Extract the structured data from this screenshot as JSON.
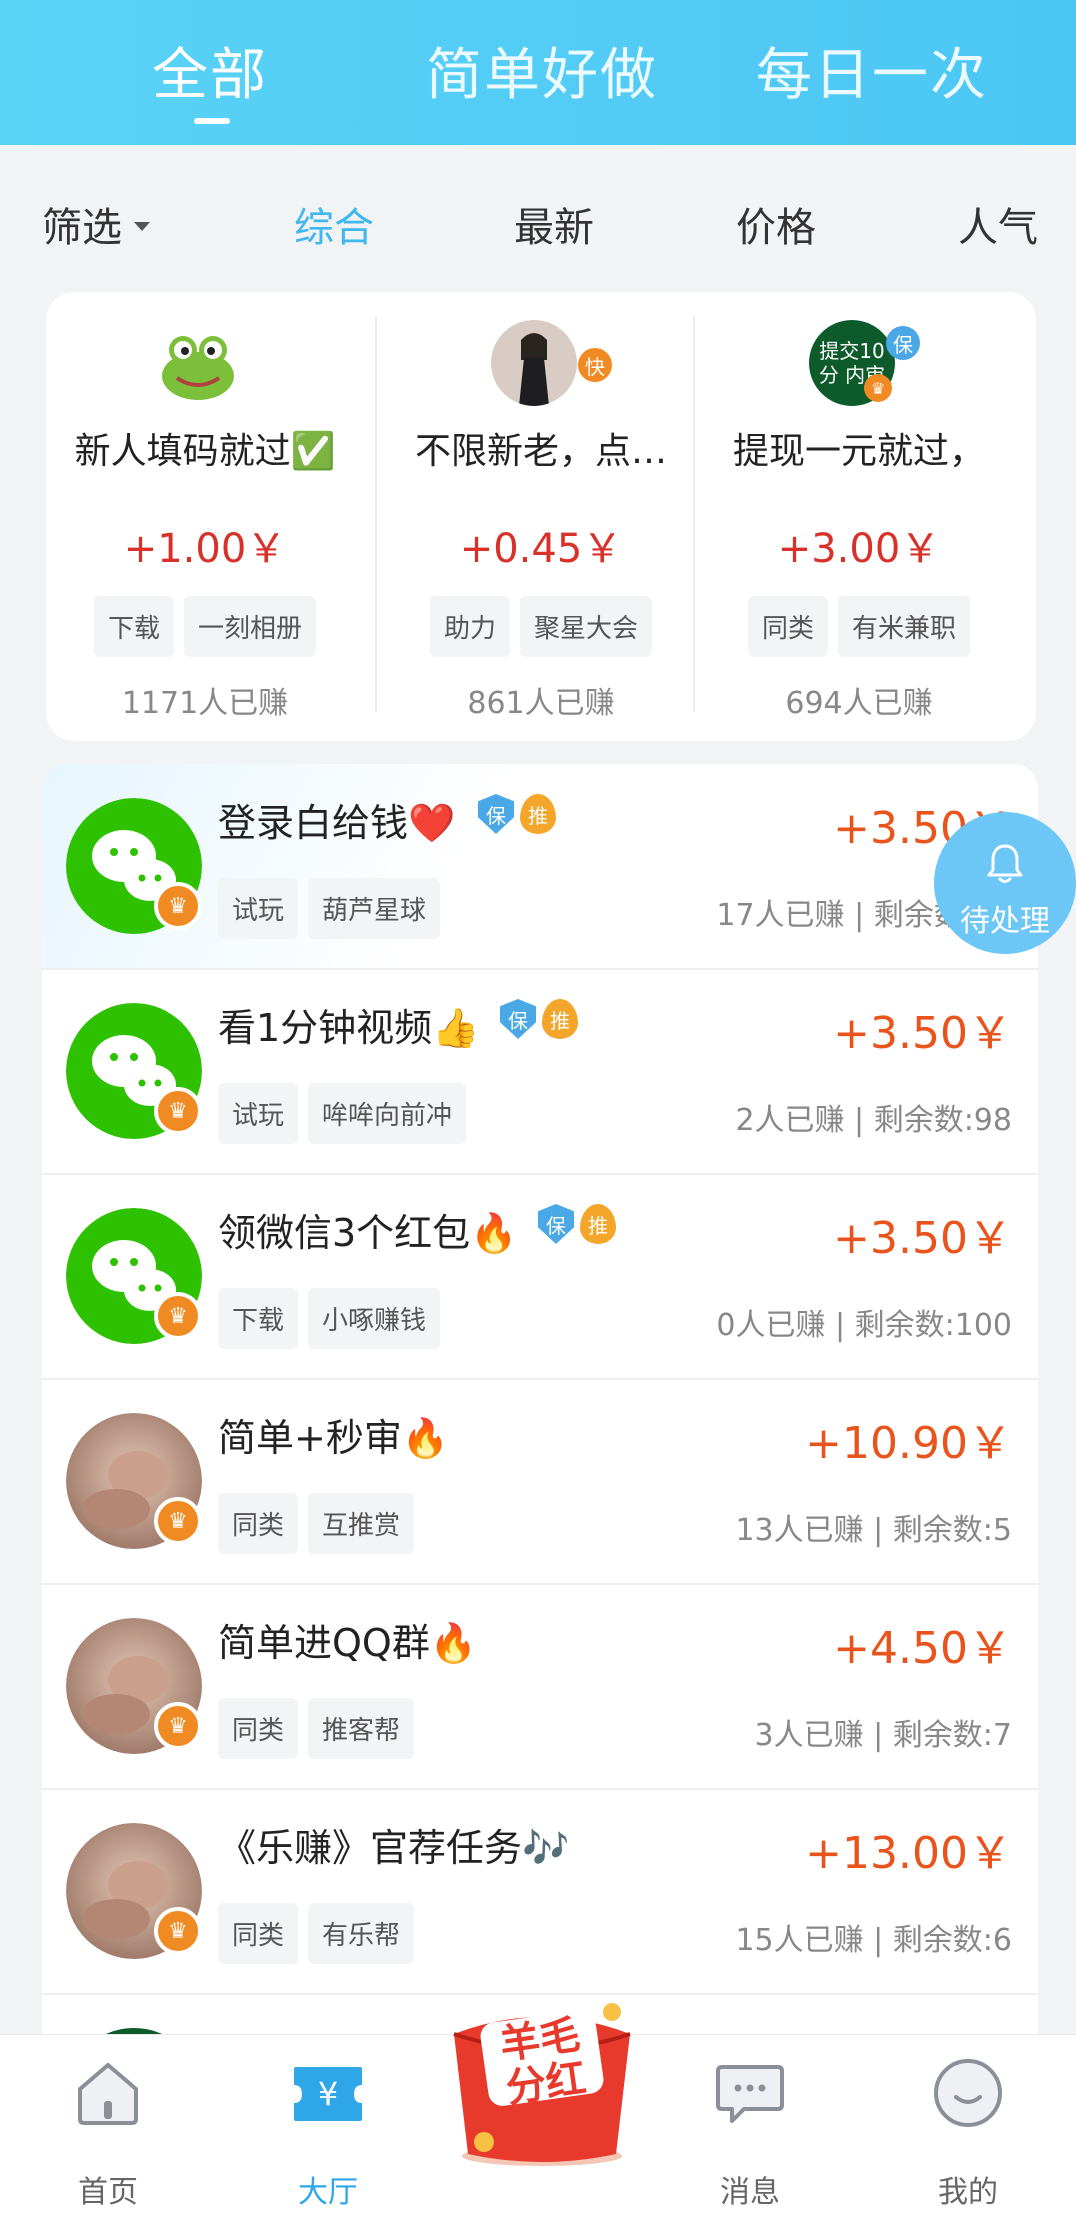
{
  "top_tabs": [
    "全部",
    "简单好做",
    "每日一次"
  ],
  "filter_bar": {
    "filter_label": "筛选",
    "sorts": [
      "综合",
      "最新",
      "价格",
      "人气"
    ]
  },
  "featured": [
    {
      "title": "新人填码就过✅",
      "price": "+1.00￥",
      "tags": [
        "下载",
        "一刻相册"
      ],
      "earned": "1171人已赚",
      "badge": ""
    },
    {
      "title": "不限新老，点…",
      "price": "+0.45￥",
      "tags": [
        "助力",
        "聚星大会"
      ],
      "earned": "861人已赚",
      "badge": "快"
    },
    {
      "title": "提现一元就过，",
      "price": "+3.00￥",
      "tags": [
        "同类",
        "有米兼职"
      ],
      "earned": "694人已赚",
      "badge": "保",
      "avatar_text": "提交10分 内审"
    }
  ],
  "tasks": [
    {
      "title": "登录白给钱❤️",
      "price": "+3.50￥",
      "tags": [
        "试玩",
        "葫芦星球"
      ],
      "stats": "17人已赚 | 剩余数:98",
      "avatar": "wechat",
      "badges": [
        "保",
        "推"
      ]
    },
    {
      "title": "看1分钟视频👍",
      "price": "+3.50￥",
      "tags": [
        "试玩",
        "哞哞向前冲"
      ],
      "stats": "2人已赚 | 剩余数:98",
      "avatar": "wechat",
      "badges": [
        "保",
        "推"
      ]
    },
    {
      "title": "领微信3个红包🔥",
      "price": "+3.50￥",
      "tags": [
        "下载",
        "小啄赚钱"
      ],
      "stats": "0人已赚 | 剩余数:100",
      "avatar": "wechat",
      "badges": [
        "保",
        "推"
      ]
    },
    {
      "title": "简单+秒审🔥",
      "price": "+10.90￥",
      "tags": [
        "同类",
        "互推赏"
      ],
      "stats": "13人已赚 | 剩余数:5",
      "avatar": "photo",
      "badges": []
    },
    {
      "title": "简单进QQ群🔥",
      "price": "+4.50￥",
      "tags": [
        "同类",
        "推客帮"
      ],
      "stats": "3人已赚 | 剩余数:7",
      "avatar": "photo",
      "badges": []
    },
    {
      "title": "《乐赚》官荐任务🎶",
      "price": "+13.00￥",
      "tags": [
        "同类",
        "有乐帮"
      ],
      "stats": "15人已赚 | 剩余数:6",
      "avatar": "photo",
      "badges": []
    }
  ],
  "pending_button": {
    "label": "待处理",
    "icon": "bell-icon"
  },
  "bottom_nav": {
    "items": [
      {
        "label": "首页",
        "icon": "home-icon"
      },
      {
        "label": "大厅",
        "icon": "ticket-icon",
        "active": true
      },
      {
        "label": "消息",
        "icon": "message-icon"
      },
      {
        "label": "我的",
        "icon": "profile-icon"
      }
    ],
    "center_badge": "羊毛分红"
  },
  "colors": {
    "accent": "#4cc6f4",
    "price_featured": "#d8312a",
    "price_list": "#e9541d",
    "crown": "#f08a22",
    "wechat": "#2dc100"
  }
}
